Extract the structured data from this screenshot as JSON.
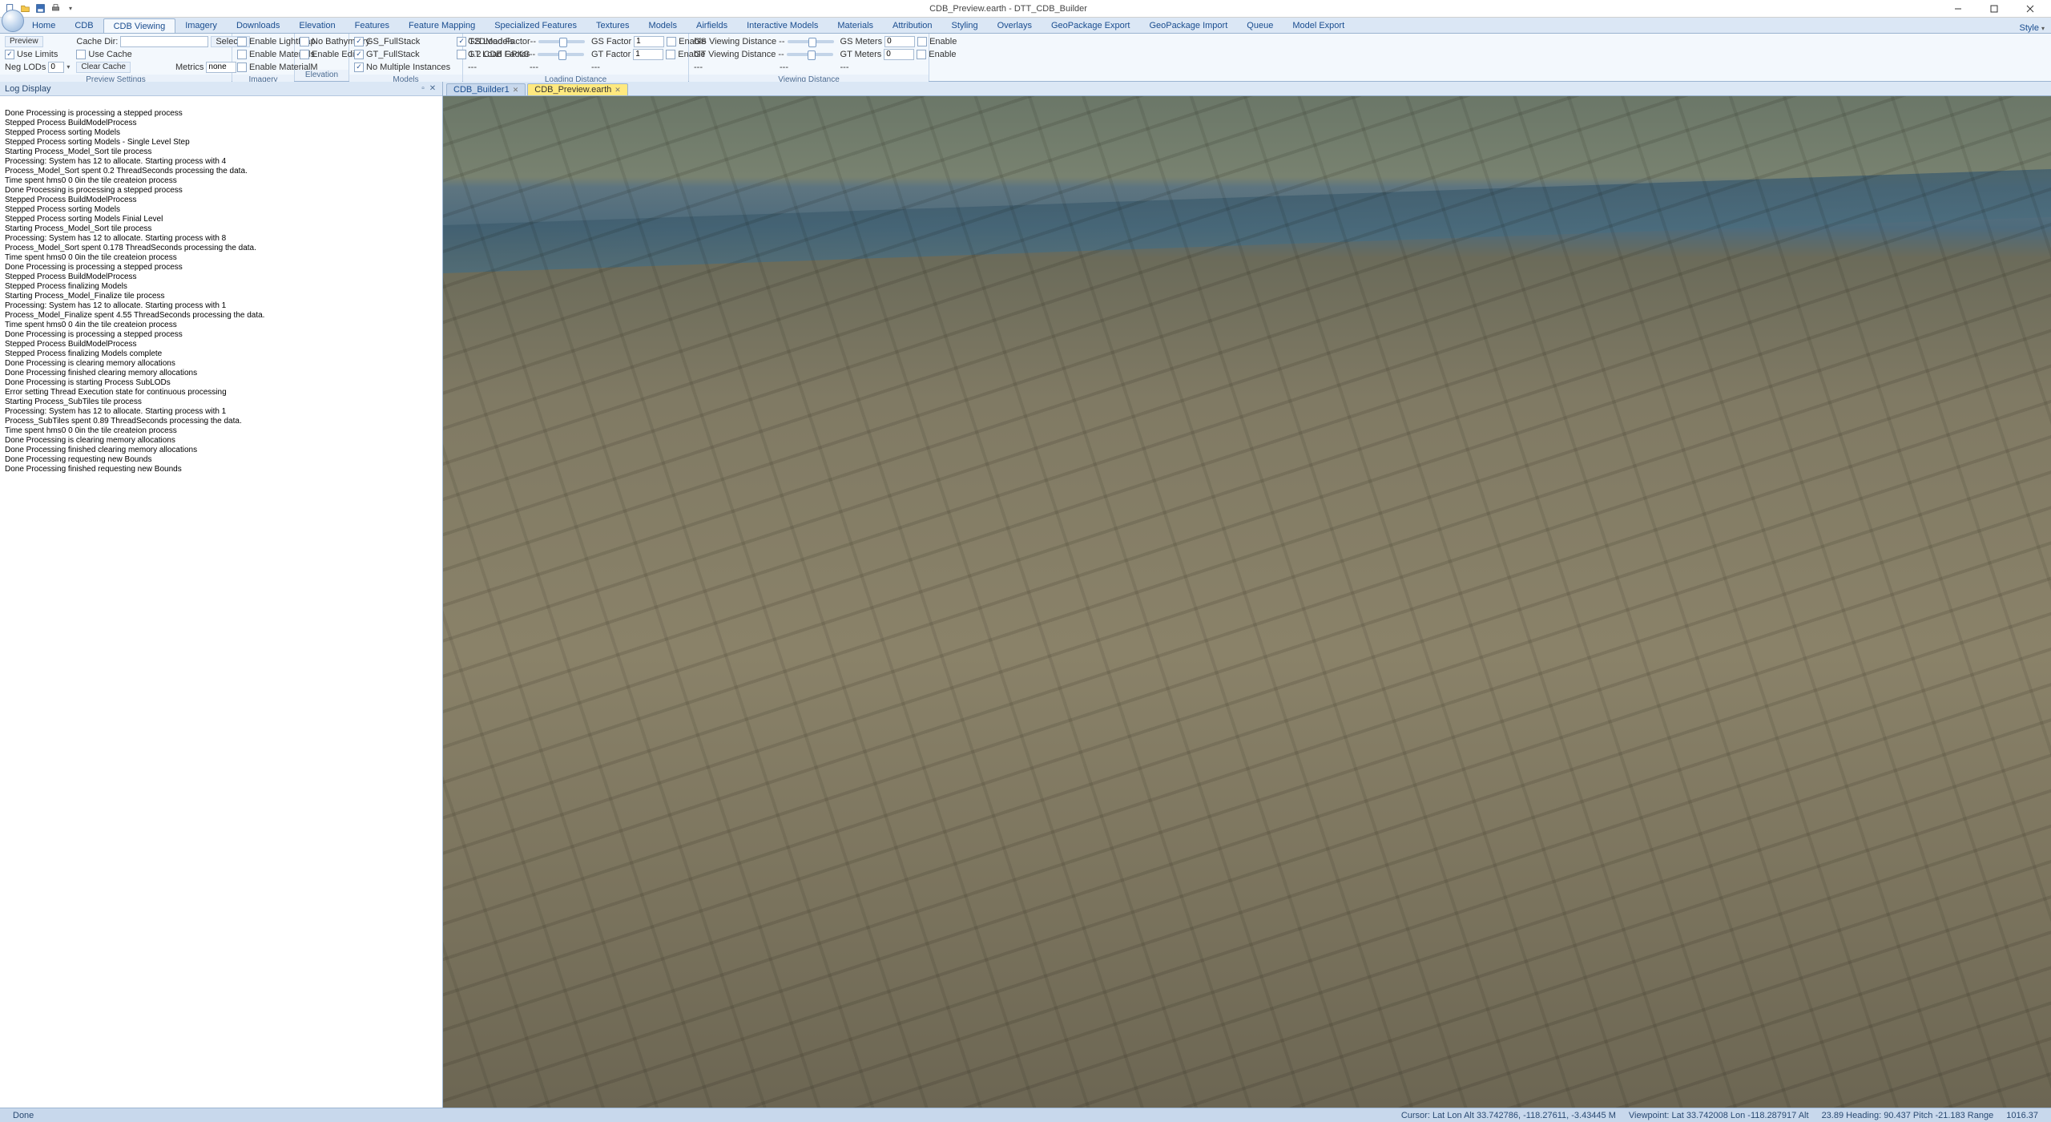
{
  "title": "CDB_Preview.earth - DTT_CDB_Builder",
  "ribbon_tabs": [
    "Home",
    "CDB",
    "CDB Viewing",
    "Imagery",
    "Downloads",
    "Elevation",
    "Features",
    "Feature Mapping",
    "Specialized Features",
    "Textures",
    "Models",
    "Airfields",
    "Interactive Models",
    "Materials",
    "Attribution",
    "Styling",
    "Overlays",
    "GeoPackage Export",
    "GeoPackage Import",
    "Queue",
    "Model Export"
  ],
  "ribbon_active_index": 2,
  "style_menu": "Style",
  "ribbon": {
    "preview": {
      "label": "Preview Settings",
      "preview": "Preview",
      "cache_dir": "Cache Dir:",
      "select": "Select",
      "use_limits": "Use Limits",
      "use_cache": "Use Cache",
      "neg_lods": "Neg LODs",
      "neg_lods_val": "0",
      "clear_cache": "Clear Cache",
      "metrics": "Metrics",
      "metrics_val": "none"
    },
    "imagery": {
      "label": "Imagery",
      "enable_lightmap": "Enable LightMap",
      "enable_materials": "Enable Materials",
      "enable_materialm": "Enable MaterialM"
    },
    "elevation": {
      "label": "Elevation",
      "no_bathymetry": "No Bathymetry",
      "enable_edit": "Enable Edit"
    },
    "models": {
      "label": "Models",
      "gs_fullstack": "GS_FullStack",
      "gt_fullstack": "GT_FullStack",
      "no_multiple": "No Multiple Instances",
      "t2dmodels": "T2DModels",
      "cdb_gpkg": "1.2 CDB GPKG"
    },
    "loading": {
      "label": "Loading Distance",
      "gs_load": "GS Load Factor--",
      "gt_load": "GT Load Factor--",
      "dash": "---",
      "gs_factor": "GS Factor",
      "gt_factor": "GT Factor",
      "val": "1",
      "enable": "Enable"
    },
    "viewing": {
      "label": "Viewing Distance",
      "gs_view": "GS Viewing Distance --",
      "gt_view": "GT Viewing Distance --",
      "dash": "---",
      "gs_meters": "GS Meters",
      "gt_meters": "GT Meters",
      "val": "0",
      "enable": "Enable"
    }
  },
  "log_title": "Log Display",
  "log_lines": [
    "Done Processing is processing a stepped process",
    "Stepped Process BuildModelProcess",
    "Stepped Process sorting Models",
    "Stepped Process sorting Models - Single Level Step",
    "Starting Process_Model_Sort tile process",
    "Processing: System has 12 to allocate. Starting process with 4",
    "Process_Model_Sort spent 0.2 ThreadSeconds processing the data.",
    "Time spent hms0 0 0in the tile createion process",
    "Done Processing is processing a stepped process",
    "Stepped Process BuildModelProcess",
    "Stepped Process sorting Models",
    "Stepped Process sorting Models Finial Level",
    "Starting Process_Model_Sort tile process",
    "Processing: System has 12 to allocate. Starting process with 8",
    "Process_Model_Sort spent 0.178 ThreadSeconds processing the data.",
    "Time spent hms0 0 0in the tile createion process",
    "Done Processing is processing a stepped process",
    "Stepped Process BuildModelProcess",
    "Stepped Process finalizing Models",
    "Starting Process_Model_Finalize tile process",
    "Processing: System has 12 to allocate. Starting process with 1",
    "Process_Model_Finalize spent 4.55 ThreadSeconds processing the data.",
    "Time spent hms0 0 4in the tile createion process",
    "Done Processing is processing a stepped process",
    "Stepped Process BuildModelProcess",
    "Stepped Process finalizing Models complete",
    "Done Processing is clearing memory allocations",
    "Done Processing finished clearing memory allocations",
    "Done Processing is starting Process SubLODs",
    "Error setting Thread Execution state for continuous processing",
    "Starting Process_SubTiles tile process",
    "Processing: System has 12 to allocate. Starting process with 1",
    "Process_SubTiles spent 0.89 ThreadSeconds processing the data.",
    "Time spent hms0 0 0in the tile createion process",
    "Done Processing is clearing memory allocations",
    "Done Processing finished clearing memory allocations",
    "Done Processing requesting new Bounds",
    "Done Processing finished requesting new Bounds"
  ],
  "doc_tabs": [
    {
      "label": "CDB_Builder1",
      "active": false
    },
    {
      "label": "CDB_Preview.earth",
      "active": true
    }
  ],
  "status": {
    "left": "Done",
    "cursor": "Cursor: Lat Lon Alt 33.742786, -118.27611, -3.43445 M",
    "viewpoint": "Viewpoint: Lat 33.742008 Lon -118.287917 Alt",
    "heading": "23.89 Heading:  90.437 Pitch -21.183 Range",
    "end": "1016.37"
  }
}
